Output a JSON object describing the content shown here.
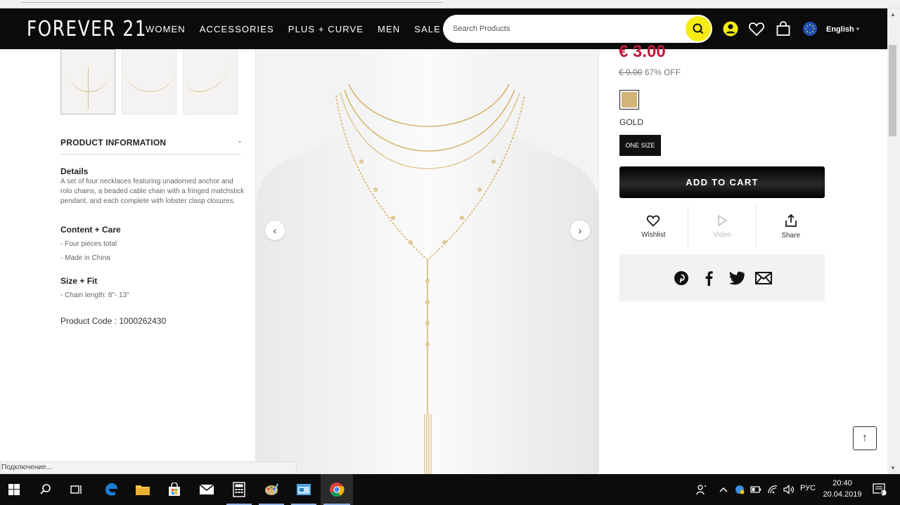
{
  "browser": {
    "status_text": "Подключение..."
  },
  "header": {
    "logo": "FOREVER 21",
    "nav": [
      "WOMEN",
      "ACCESSORIES",
      "PLUS + CURVE",
      "MEN",
      "SALE"
    ],
    "search_placeholder": "Search Products",
    "language": "English"
  },
  "product_info": {
    "section_title": "PRODUCT INFORMATION",
    "toggle": "-",
    "details_label": "Details",
    "details_text": "A set of four necklaces featuring unadorned anchor and rolo chains, a beaded cable chain with a fringed matchstick pendant, and each complete with lobster clasp closures.",
    "content_label": "Content + Care",
    "content_items": [
      "- Four pieces total",
      "- Made in China"
    ],
    "size_label": "Size + Fit",
    "size_items": [
      "- Chain length: 8\"- 13\""
    ],
    "product_code": "Product Code : 1000262430"
  },
  "gallery": {
    "prev": "‹",
    "next": "›"
  },
  "purchase": {
    "price": "€ 3.00",
    "original_price": "€ 9.00",
    "discount": "67% OFF",
    "swatch_color": "#d4b377",
    "color_name": "GOLD",
    "size": "ONE SIZE",
    "add_to_cart": "ADD TO CART",
    "actions": {
      "wishlist": "Wishlist",
      "video": "Video",
      "share": "Share"
    }
  },
  "back_to_top": "↑",
  "taskbar": {
    "lang": "РУС",
    "time": "20:40",
    "date": "20.04.2019",
    "notifications": "6"
  },
  "colors": {
    "accent": "#c4183c",
    "search_button": "#f7ec13",
    "header_bg": "#0b0b0b"
  }
}
